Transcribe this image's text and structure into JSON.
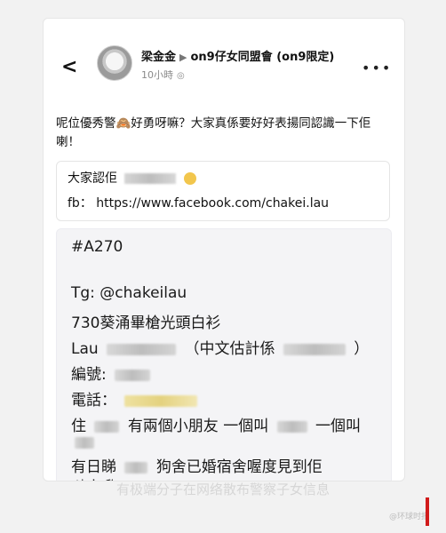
{
  "post": {
    "author": "梁金金",
    "group": "on9仔女同盟會 (on9限定)",
    "time": "10小時",
    "text": "呢位優秀警🙈好勇呀嘛？大家真係要好好表揚同認識一下佢喇！"
  },
  "quote": {
    "line1_prefix": "大家認佢",
    "fb_label": "fb：",
    "fb_url": "https://www.facebook.com/chakei.lau"
  },
  "details": {
    "tag": "#A270",
    "tg": "Tg: @chakeilau",
    "line3": "730葵涌畢槍光頭白衫",
    "line4_prefix": "Lau",
    "line4_suffix": "（中文估計係",
    "line5_prefix": "編號:",
    "line6_prefix": "電話：",
    "line7_prefix": "住",
    "line7_mid": "有兩個小朋友 一個叫",
    "line7_suffix": "一個叫",
    "line8_prefix": "有日睇",
    "line8_suffix": "狗舍已婚宿舍喔度見到佢",
    "line9": "哋出嚟"
  },
  "caption": "有极端分子在网络散布警察子女信息",
  "watermark": "@环球时报"
}
